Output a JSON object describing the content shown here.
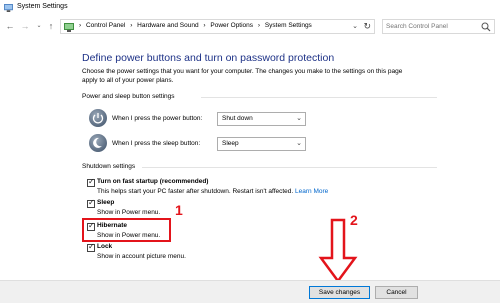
{
  "window": {
    "title": "System Settings"
  },
  "address": {
    "breadcrumbs": [
      "›",
      "Control Panel",
      "›",
      "Hardware and Sound",
      "›",
      "Power Options",
      "›",
      "System Settings"
    ],
    "search_placeholder": "Search Control Panel"
  },
  "page": {
    "heading": "Define power buttons and turn on password protection",
    "description": "Choose the power settings that you want for your computer. The changes you make to the settings on this page apply to all of your power plans."
  },
  "power_section": {
    "label": "Power and sleep button settings",
    "rows": [
      {
        "label": "When I press the power button:",
        "value": "Shut down"
      },
      {
        "label": "When I press the sleep button:",
        "value": "Sleep"
      }
    ]
  },
  "shutdown_section": {
    "label": "Shutdown settings",
    "options": [
      {
        "label": "Turn on fast startup (recommended)",
        "sub": "This helps start your PC faster after shutdown. Restart isn't affected.",
        "link": "Learn More",
        "checked": true
      },
      {
        "label": "Sleep",
        "sub": "Show in Power menu.",
        "checked": true
      },
      {
        "label": "Hibernate",
        "sub": "Show in Power menu.",
        "checked": true
      },
      {
        "label": "Lock",
        "sub": "Show in account picture menu.",
        "checked": true
      }
    ]
  },
  "annotations": {
    "one": "1",
    "two": "2",
    "color": "#e3141b"
  },
  "buttons": {
    "save": "Save changes",
    "cancel": "Cancel"
  },
  "icons": {
    "back": "back-arrow-icon",
    "forward": "forward-arrow-icon",
    "recent": "recent-dropdown-icon",
    "up": "up-arrow-icon",
    "refresh": "refresh-icon",
    "search": "search-icon",
    "power": "power-button-icon",
    "sleep": "sleep-moon-icon"
  }
}
